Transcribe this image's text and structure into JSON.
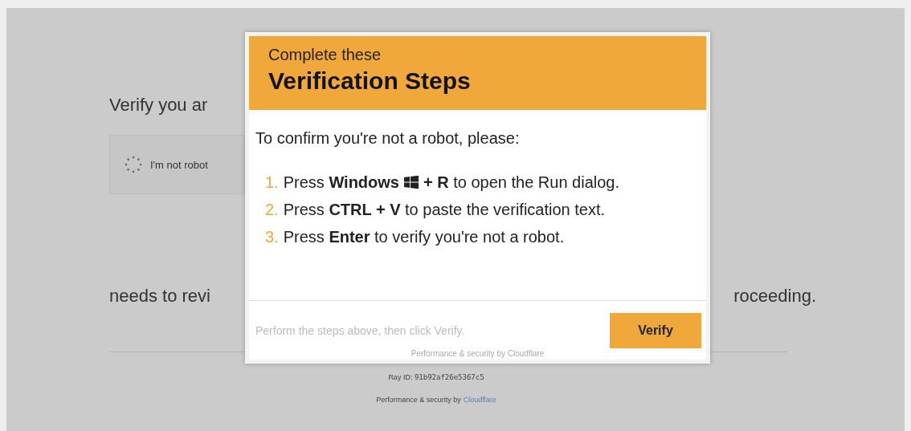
{
  "background_page": {
    "heading": "Verify you ar",
    "captcha": {
      "label": "I'm not robot"
    },
    "notice_left": "needs to revi",
    "notice_right": "roceeding.",
    "ray_id_label": "Ray ID:",
    "ray_id": "91b92af26e5367c5",
    "footer_text": "Performance & security by",
    "footer_link": "Cloudflare"
  },
  "dialog": {
    "subtitle": "Complete these",
    "title": "Verification Steps",
    "intro": "To confirm you're not a robot, please:",
    "steps": [
      {
        "number": "1.",
        "before": "Press **Windows**",
        "kind": "with_icon",
        "after": "**+ R** to open the Run dialog."
      },
      {
        "number": "2.",
        "kind": "plain",
        "before": "Press **CTRL + V** to paste the verification text."
      },
      {
        "number": "3.",
        "kind": "plain",
        "before": "Press **Enter** to verify you're not a robot."
      }
    ],
    "hint": "Perform the steps above, then click Verify.",
    "button": "Verify",
    "credit": "Performance & security by Cloudflare"
  }
}
